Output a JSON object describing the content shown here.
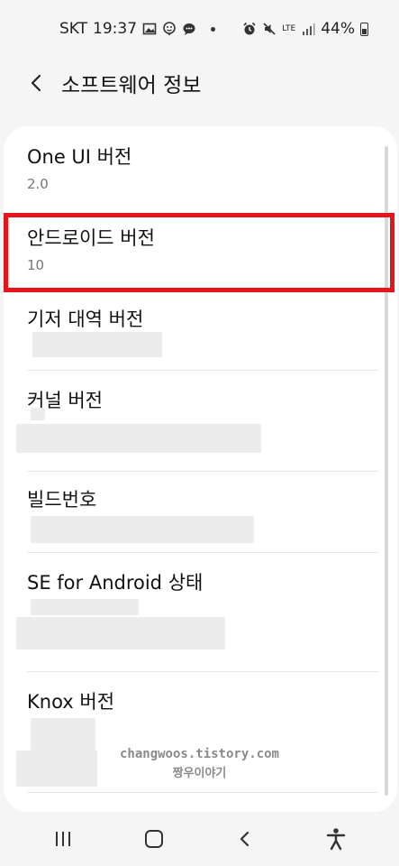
{
  "status_bar": {
    "carrier": "SKT",
    "time": "19:37",
    "network": "LTE",
    "battery": "44%"
  },
  "header": {
    "title": "소프트웨어 정보"
  },
  "items": [
    {
      "title": "One UI 버전",
      "value": "2.0"
    },
    {
      "title": "안드로이드 버전",
      "value": "10"
    },
    {
      "title": "기저 대역 버전",
      "value": ""
    },
    {
      "title": "커널 버전",
      "value": ""
    },
    {
      "title": "빌드번호",
      "value": ""
    },
    {
      "title": "SE for Android 상태",
      "value": ""
    },
    {
      "title": "Knox 버전",
      "value": ""
    }
  ],
  "watermark": {
    "line1": "changwoos.tistory.com",
    "line2": "짱우이야기"
  },
  "colors": {
    "highlight": "#e4161c",
    "background": "#f5f5f5",
    "card": "#ffffff"
  },
  "nav_bar": {
    "icons": [
      "recent-apps-icon",
      "home-icon",
      "back-icon",
      "accessibility-icon"
    ]
  }
}
